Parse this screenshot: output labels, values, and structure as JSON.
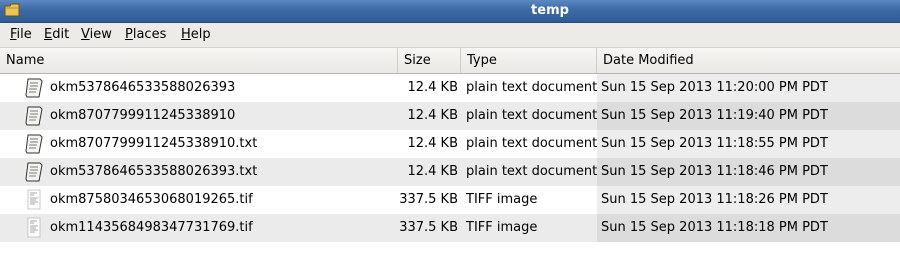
{
  "window": {
    "title": "temp"
  },
  "menubar": [
    {
      "label": "File",
      "mnemonic": "F",
      "rest": "ile"
    },
    {
      "label": "Edit",
      "mnemonic": "E",
      "rest": "dit"
    },
    {
      "label": "View",
      "mnemonic": "V",
      "rest": "iew"
    },
    {
      "label": "Places",
      "mnemonic": "P",
      "rest": "laces"
    },
    {
      "label": "Help",
      "mnemonic": "H",
      "rest": "elp"
    }
  ],
  "columns": {
    "name": "Name",
    "size": "Size",
    "type": "Type",
    "date": "Date Modified"
  },
  "files": [
    {
      "name": "okm5378646533588026393",
      "size": "12.4 KB",
      "type": "plain text document",
      "date": "Sun 15 Sep 2013 11:20:00 PM PDT",
      "icon": "text-document-icon"
    },
    {
      "name": "okm8707799911245338910",
      "size": "12.4 KB",
      "type": "plain text document",
      "date": "Sun 15 Sep 2013 11:19:40 PM PDT",
      "icon": "text-document-icon"
    },
    {
      "name": "okm8707799911245338910.txt",
      "size": "12.4 KB",
      "type": "plain text document",
      "date": "Sun 15 Sep 2013 11:18:55 PM PDT",
      "icon": "text-document-icon"
    },
    {
      "name": "okm5378646533588026393.txt",
      "size": "12.4 KB",
      "type": "plain text document",
      "date": "Sun 15 Sep 2013 11:18:46 PM PDT",
      "icon": "text-document-icon"
    },
    {
      "name": "okm8758034653068019265.tif",
      "size": "337.5 KB",
      "type": "TIFF image",
      "date": "Sun 15 Sep 2013 11:18:26 PM PDT",
      "icon": "tiff-image-icon"
    },
    {
      "name": "okm1143568498347731769.tif",
      "size": "337.5 KB",
      "type": "TIFF image",
      "date": "Sun 15 Sep 2013 11:18:18 PM PDT",
      "icon": "tiff-image-icon"
    }
  ],
  "colors": {
    "titlebar": "#3d6aa5",
    "menubar": "#ecebe8",
    "row_alt": "#ebebeb",
    "sorted_column": "#ededed"
  }
}
